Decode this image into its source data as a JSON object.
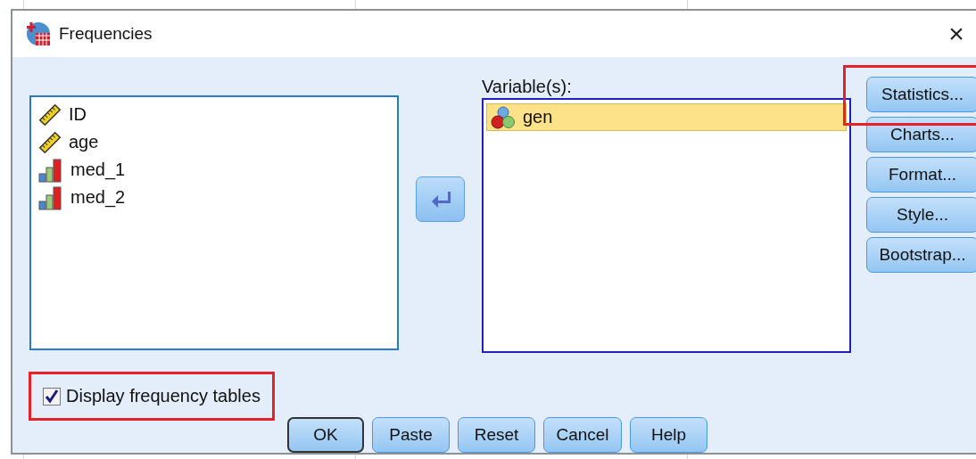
{
  "window": {
    "title": "Frequencies",
    "close": "×"
  },
  "source_list": {
    "items": [
      {
        "name": "ID",
        "kind": "scale",
        "selected": false
      },
      {
        "name": "age",
        "kind": "scale",
        "selected": false
      },
      {
        "name": "med_1",
        "kind": "ordinal",
        "selected": false
      },
      {
        "name": "med_2",
        "kind": "ordinal",
        "selected": false
      }
    ]
  },
  "variables": {
    "label": "Variable(s):",
    "items": [
      {
        "name": "gen",
        "kind": "nominal",
        "selected": true
      }
    ]
  },
  "side_buttons": [
    {
      "label": "Statistics...",
      "highlighted": true
    },
    {
      "label": "Charts...",
      "highlighted": false
    },
    {
      "label": "Format...",
      "highlighted": false
    },
    {
      "label": "Style...",
      "highlighted": false
    },
    {
      "label": "Bootstrap...",
      "highlighted": false
    }
  ],
  "display_frequency_tables": {
    "label": "Display frequency tables",
    "checked": true,
    "highlighted": true
  },
  "buttons": [
    {
      "label": "OK",
      "default": true
    },
    {
      "label": "Paste",
      "default": false
    },
    {
      "label": "Reset",
      "default": false
    },
    {
      "label": "Cancel",
      "default": false
    },
    {
      "label": "Help",
      "default": false
    }
  ]
}
